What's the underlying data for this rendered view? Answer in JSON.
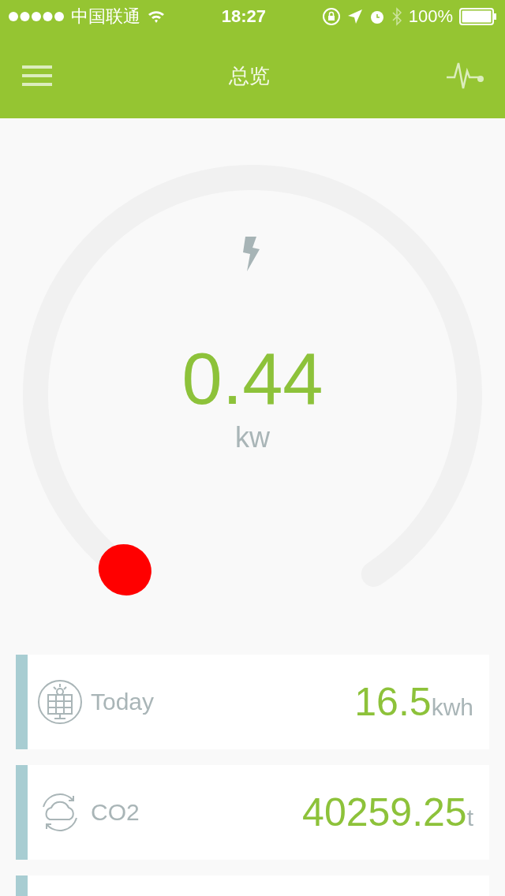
{
  "status_bar": {
    "carrier": "中国联通",
    "time": "18:27",
    "battery": "100%"
  },
  "header": {
    "title": "总览"
  },
  "gauge": {
    "value": "0.44",
    "unit": "kw"
  },
  "cards": [
    {
      "kind": "stat",
      "label": "Today",
      "value": "16.5",
      "unit": "kwh"
    },
    {
      "kind": "stat",
      "label": "CO2",
      "value": "40259.25",
      "unit": "t"
    },
    {
      "kind": "empty"
    }
  ]
}
